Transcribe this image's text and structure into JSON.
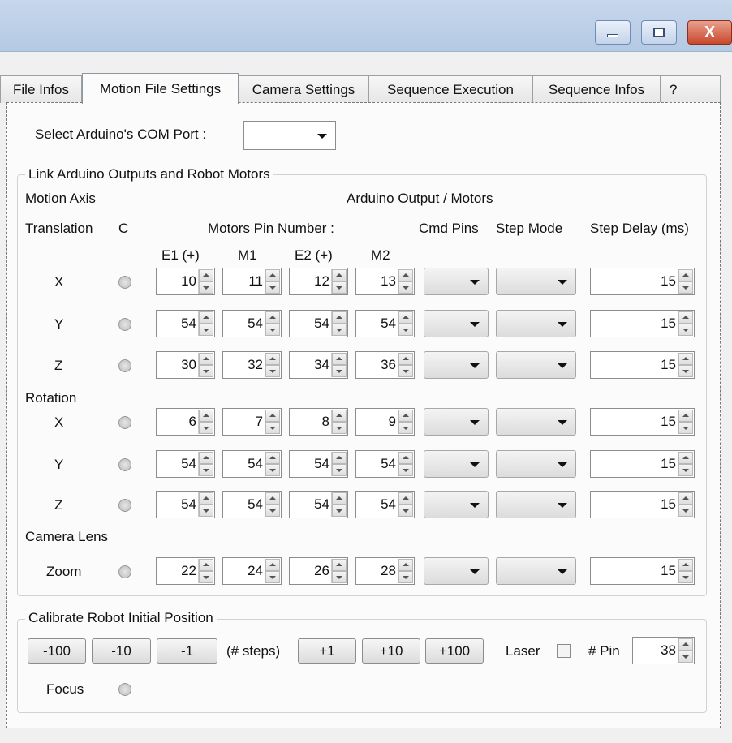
{
  "window": {
    "controls": {
      "minimize_icon": "minimize-icon",
      "maximize_icon": "maximize-icon",
      "close_icon": "close-icon",
      "close_glyph": "X"
    }
  },
  "tabs": [
    {
      "label": "File Infos",
      "active": false
    },
    {
      "label": "Motion File Settings",
      "active": true
    },
    {
      "label": "Camera Settings",
      "active": false
    },
    {
      "label": "Sequence Execution",
      "active": false
    },
    {
      "label": "Sequence Infos",
      "active": false
    },
    {
      "label": "?",
      "active": false
    }
  ],
  "com_port": {
    "label": "Select Arduino's COM Port :",
    "value": ""
  },
  "link_group": {
    "title": "Link Arduino Outputs and Robot Motors",
    "motion_axis": "Motion Axis",
    "arduino_output": "Arduino Output / Motors",
    "translation": "Translation",
    "c_header": "C",
    "motors_pin_number": "Motors Pin Number :",
    "cmd_pins": "Cmd Pins",
    "step_mode": "Step Mode",
    "step_delay": "Step Delay (ms)",
    "pin_headers": [
      "E1 (+)",
      "M1",
      "E2 (+)",
      "M2"
    ],
    "rotation": "Rotation",
    "camera_lens": "Camera Lens"
  },
  "rows": [
    {
      "label": "X",
      "pins": [
        "10",
        "11",
        "12",
        "13"
      ],
      "cmd_pins": "",
      "step_mode": "",
      "step_delay": "15"
    },
    {
      "label": "Y",
      "pins": [
        "54",
        "54",
        "54",
        "54"
      ],
      "cmd_pins": "",
      "step_mode": "",
      "step_delay": "15"
    },
    {
      "label": "Z",
      "pins": [
        "30",
        "32",
        "34",
        "36"
      ],
      "cmd_pins": "",
      "step_mode": "",
      "step_delay": "15"
    },
    {
      "label": "X",
      "pins": [
        "6",
        "7",
        "8",
        "9"
      ],
      "cmd_pins": "",
      "step_mode": "",
      "step_delay": "15"
    },
    {
      "label": "Y",
      "pins": [
        "54",
        "54",
        "54",
        "54"
      ],
      "cmd_pins": "",
      "step_mode": "",
      "step_delay": "15"
    },
    {
      "label": "Z",
      "pins": [
        "54",
        "54",
        "54",
        "54"
      ],
      "cmd_pins": "",
      "step_mode": "",
      "step_delay": "15"
    },
    {
      "label": "Zoom",
      "pins": [
        "22",
        "24",
        "26",
        "28"
      ],
      "cmd_pins": "",
      "step_mode": "",
      "step_delay": "15"
    }
  ],
  "calibrate_group": {
    "title": "Calibrate Robot Initial Position",
    "buttons": [
      "-100",
      "-10",
      "-1",
      "+1",
      "+10",
      "+100"
    ],
    "steps_label": "(# steps)",
    "laser_label": "Laser",
    "laser_checked": false,
    "pin_label": "# Pin",
    "pin_value": "38",
    "focus_label": "Focus"
  }
}
